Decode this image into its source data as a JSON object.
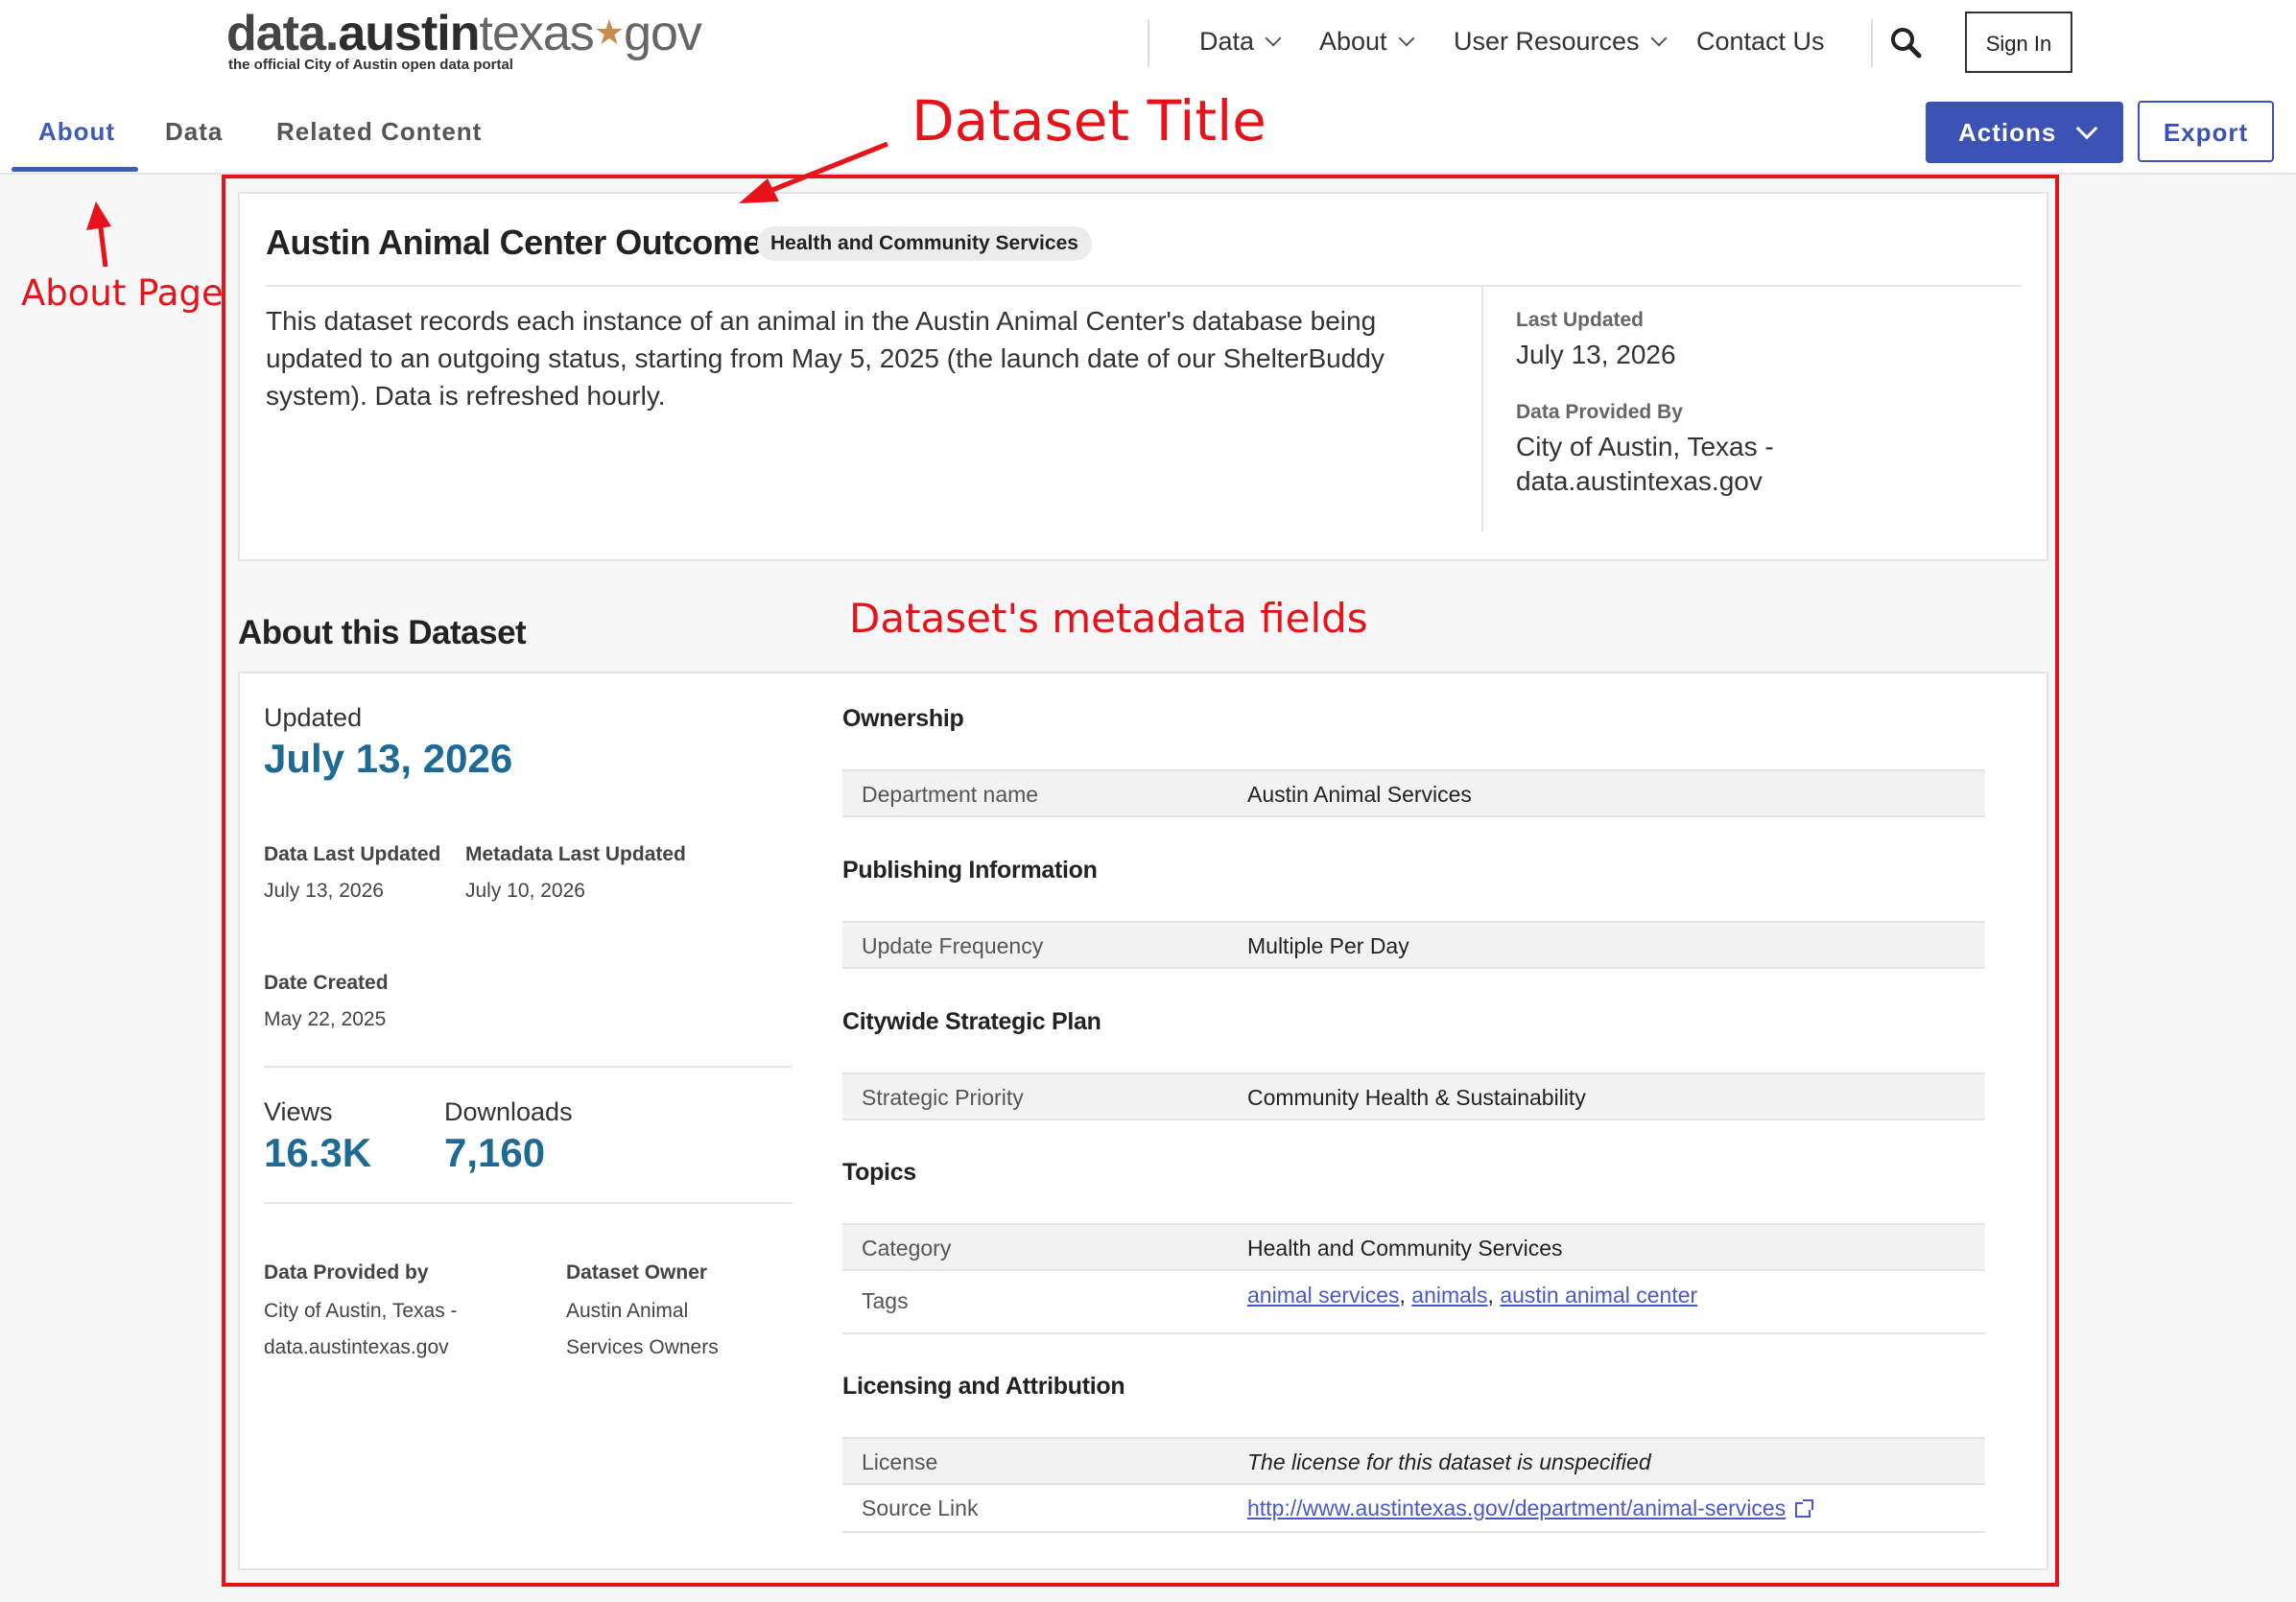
{
  "header": {
    "logo_part1": "data.",
    "logo_part2": "austin",
    "logo_part3": "texas",
    "logo_star": "★",
    "logo_part4": "gov",
    "logo_subtitle": "the official City of Austin open data portal",
    "nav": [
      "Data",
      "About",
      "User Resources",
      "Contact Us"
    ],
    "sign_in": "Sign In",
    "search_icon": "search-icon"
  },
  "subnav": {
    "tabs": [
      "About",
      "Data",
      "Related Content"
    ],
    "active_tab": "About",
    "actions_label": "Actions",
    "export_label": "Export"
  },
  "annotations": {
    "dataset_title": "Dataset Title",
    "about_page": "About Page",
    "metadata_fields": "Dataset's metadata fields"
  },
  "dataset": {
    "title": "Austin Animal Center Outcomes",
    "category_pill": "Health and Community Services",
    "description": "This dataset records each instance of an animal in the Austin Animal Center's database being updated to an outgoing status, starting from May 5, 2025 (the launch date of our ShelterBuddy system). Data is refreshed hourly.",
    "last_updated_label": "Last Updated",
    "last_updated_value": "July 13, 2026",
    "provided_by_label": "Data Provided By",
    "provided_by_value": "City of Austin, Texas - data.austintexas.gov"
  },
  "about": {
    "heading": "About this Dataset",
    "updated_label": "Updated",
    "updated_value": "July 13, 2026",
    "data_last_updated_label": "Data Last Updated",
    "data_last_updated_value": "July 13, 2026",
    "metadata_last_updated_label": "Metadata Last Updated",
    "metadata_last_updated_value": "July 10, 2026",
    "date_created_label": "Date Created",
    "date_created_value": "May 22, 2025",
    "views_label": "Views",
    "views_value": "16.3K",
    "downloads_label": "Downloads",
    "downloads_value": "7,160",
    "data_provided_by_label": "Data Provided by",
    "data_provided_by_line1": "City of Austin, Texas -",
    "data_provided_by_line2": "data.austintexas.gov",
    "dataset_owner_label": "Dataset Owner",
    "dataset_owner_line1": "Austin Animal",
    "dataset_owner_line2": "Services Owners"
  },
  "metadata": {
    "ownership": {
      "heading": "Ownership",
      "department_label": "Department name",
      "department_value": "Austin Animal Services"
    },
    "publishing": {
      "heading": "Publishing Information",
      "frequency_label": "Update Frequency",
      "frequency_value": "Multiple Per Day"
    },
    "strategic": {
      "heading": "Citywide Strategic Plan",
      "priority_label": "Strategic Priority",
      "priority_value": "Community Health & Sustainability"
    },
    "topics": {
      "heading": "Topics",
      "category_label": "Category",
      "category_value": "Health and Community Services",
      "tags_label": "Tags",
      "tags": [
        "animal services",
        "animals",
        "austin animal center"
      ]
    },
    "licensing": {
      "heading": "Licensing and Attribution",
      "license_label": "License",
      "license_value": "The license for this dataset is unspecified",
      "source_label": "Source Link",
      "source_value": "http://www.austintexas.gov/department/animal-services"
    }
  },
  "colors": {
    "accent": "#3c53b5",
    "annotation": "#e8121b",
    "stat": "#1f6a94"
  }
}
